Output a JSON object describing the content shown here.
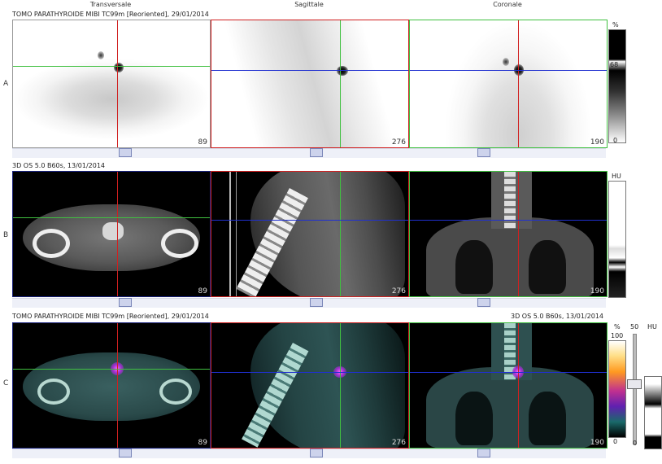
{
  "columns": {
    "transverse": "Transversale",
    "sagittal": "Sagittale",
    "coronal": "Coronale"
  },
  "rows": {
    "a": {
      "letter": "A",
      "title": "TOMO PARATHYROIDE MIBI TC99m [Reoriented], 29/01/2014"
    },
    "b": {
      "letter": "B",
      "title": "3D OS 5.0 B60s, 13/01/2014"
    },
    "c": {
      "letter": "C",
      "title_left": "TOMO PARATHYROIDE MIBI TC99m [Reoriented], 29/01/2014",
      "title_right": "3D OS 5.0 B60s, 13/01/2014"
    }
  },
  "slices": {
    "transverse": "89",
    "sagittal": "276",
    "coronal": "190"
  },
  "scale_a": {
    "unit": "%",
    "top": "68",
    "bottom": "0"
  },
  "scale_b": {
    "unit": "HU"
  },
  "scale_c": {
    "unit": "%",
    "top": "100",
    "bottom": "0",
    "blend_top": "50",
    "blend_bottom": "0",
    "hu_unit": "HU"
  },
  "colors": {
    "crosshair_red": "#d02020",
    "crosshair_green": "#40c040",
    "crosshair_blue": "#2030d0",
    "frame_blue": "#1a237e"
  }
}
